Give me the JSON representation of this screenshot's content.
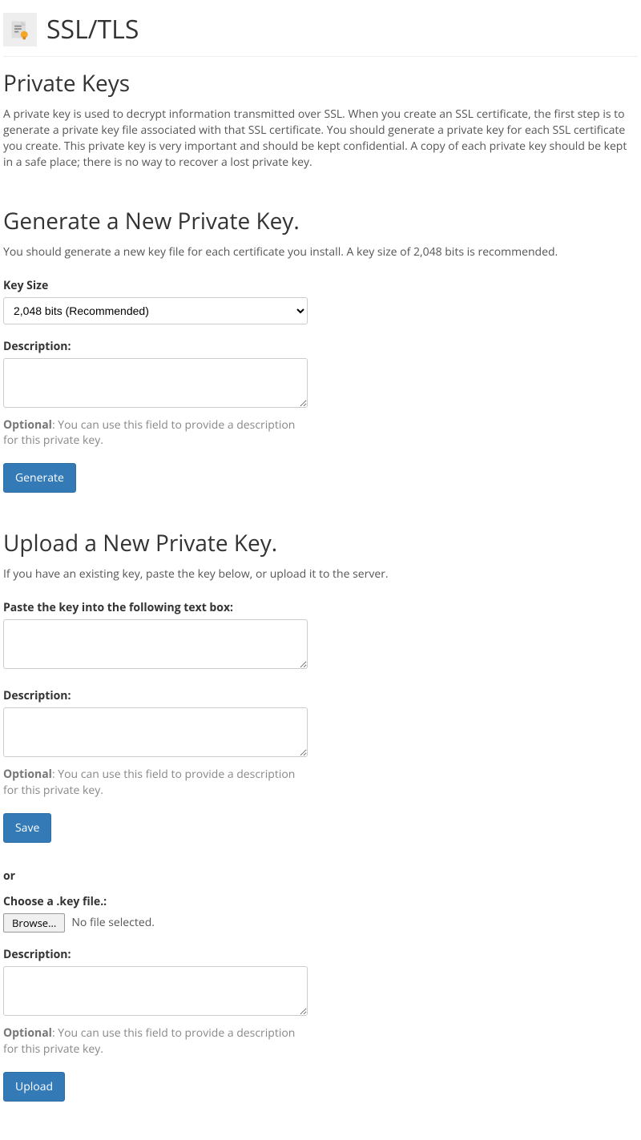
{
  "page_title": "SSL/TLS",
  "section1": {
    "heading": "Private Keys",
    "desc": "A private key is used to decrypt information transmitted over SSL. When you create an SSL certificate, the first step is to generate a private key file associated with that SSL certificate. You should generate a private key for each SSL certificate you create. This private key is very important and should be kept confidential. A copy of each private key should be kept in a safe place; there is no way to recover a lost private key."
  },
  "section2": {
    "heading": "Generate a New Private Key.",
    "desc": "You should generate a new key file for each certificate you install. A key size of 2,048 bits is recommended.",
    "keysize_label": "Key Size",
    "keysize_selected": "2,048 bits (Recommended)",
    "description_label": "Description:",
    "description_value": "",
    "optional_strong": "Optional",
    "optional_rest": ": You can use this field to provide a description for this private key.",
    "generate_btn": "Generate"
  },
  "section3": {
    "heading": "Upload a New Private Key.",
    "desc": "If you have an existing key, paste the key below, or upload it to the server.",
    "paste_label": "Paste the key into the following text box:",
    "paste_value": "",
    "description_label": "Description:",
    "description_value": "",
    "optional_strong": "Optional",
    "optional_rest": ": You can use this field to provide a description for this private key.",
    "save_btn": "Save",
    "or_text": "or",
    "choose_label": "Choose a .key file.:",
    "browse_btn": "Browse...",
    "file_status": "No file selected.",
    "description2_label": "Description:",
    "description2_value": "",
    "optional2_strong": "Optional",
    "optional2_rest": ": You can use this field to provide a description for this private key.",
    "upload_btn": "Upload"
  }
}
